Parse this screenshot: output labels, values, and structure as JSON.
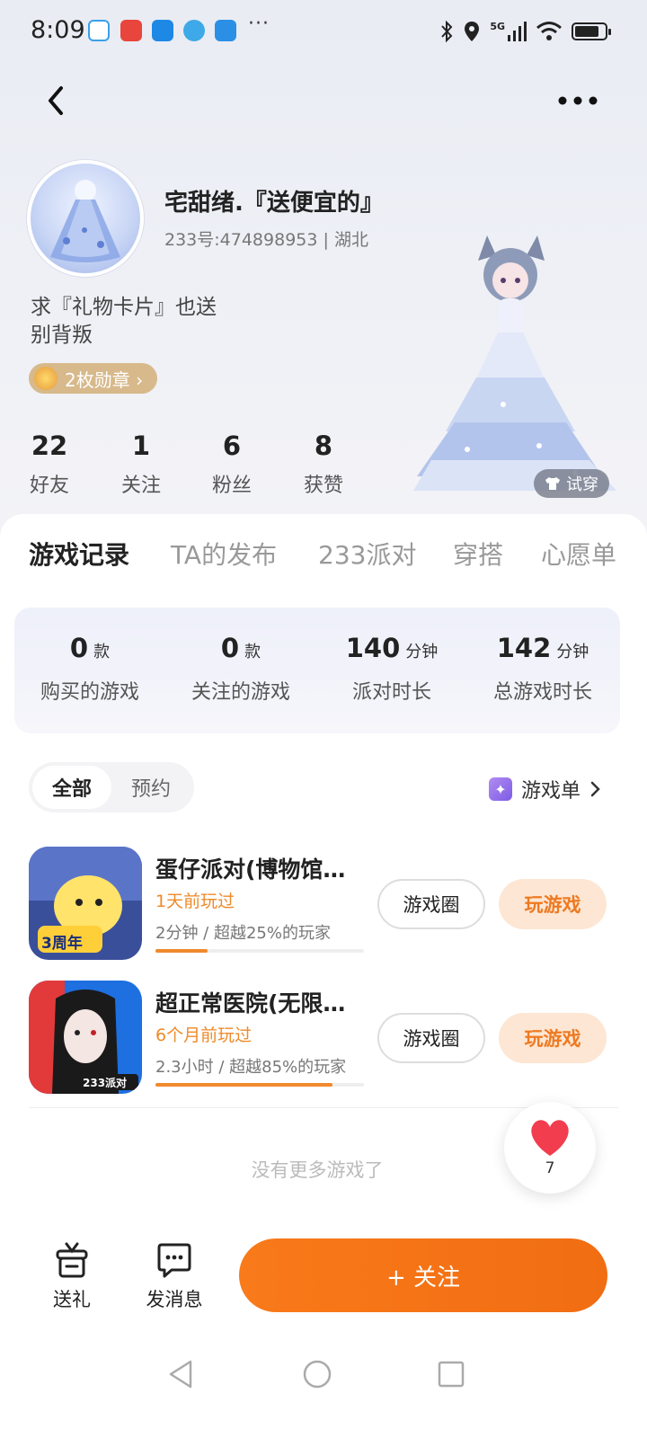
{
  "status_bar": {
    "time": "8:09",
    "network": "5G",
    "dots": "···"
  },
  "profile": {
    "nickname": "宅甜绪.『送便宜的』",
    "user_id": "233号:474898953 | 湖北",
    "bio_line1": "求『礼物卡片』也送",
    "bio_line2": "别背叛",
    "medal_label": "2枚勋章 ›",
    "try_on_label": "试穿"
  },
  "stats": [
    {
      "value": "22",
      "label": "好友"
    },
    {
      "value": "1",
      "label": "关注"
    },
    {
      "value": "6",
      "label": "粉丝"
    },
    {
      "value": "8",
      "label": "获赞"
    }
  ],
  "tabs": [
    {
      "label": "游戏记录",
      "active": true
    },
    {
      "label": "TA的发布",
      "active": false
    },
    {
      "label": "233派对",
      "active": false
    },
    {
      "label": "穿搭",
      "active": false
    },
    {
      "label": "心愿单",
      "active": false
    }
  ],
  "summary": [
    {
      "value": "0",
      "unit": "款",
      "label": "购买的游戏"
    },
    {
      "value": "0",
      "unit": "款",
      "label": "关注的游戏"
    },
    {
      "value": "140",
      "unit": "分钟",
      "label": "派对时长"
    },
    {
      "value": "142",
      "unit": "分钟",
      "label": "总游戏时长"
    }
  ],
  "filter": {
    "all": "全部",
    "reserve": "预约"
  },
  "game_list_link": "游戏单",
  "games": [
    {
      "title": "蛋仔派对(博物馆…",
      "last_played": "1天前玩过",
      "stat": "2分钟 / 超越25%的玩家",
      "progress": 0.25,
      "circle_label": "游戏圈",
      "play_label": "玩游戏",
      "icon_badge": "3周年"
    },
    {
      "title": "超正常医院(无限…",
      "last_played": "6个月前玩过",
      "stat": "2.3小时 / 超越85%的玩家",
      "progress": 0.85,
      "circle_label": "游戏圈",
      "play_label": "玩游戏",
      "icon_badge": "233派对"
    }
  ],
  "no_more": "没有更多游戏了",
  "like_count": "7",
  "actions": {
    "gift": "送礼",
    "message": "发消息",
    "follow": "+ 关注"
  },
  "colors": {
    "accent": "#f27a1a",
    "played_time": "#ee8a2a",
    "play_button_bg": "#fde6d3"
  }
}
